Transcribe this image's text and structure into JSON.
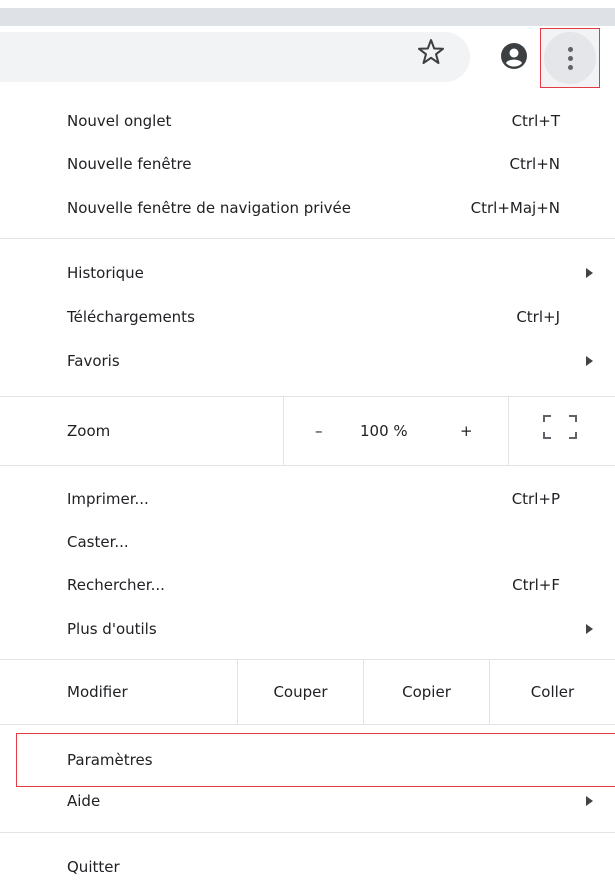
{
  "toolbar": {
    "star_icon": "star-icon",
    "account_icon": "account-icon",
    "menu_icon": "three-dot-menu-icon"
  },
  "menu": {
    "group1": [
      {
        "label": "Nouvel onglet",
        "shortcut": "Ctrl+T"
      },
      {
        "label": "Nouvelle fenêtre",
        "shortcut": "Ctrl+N"
      },
      {
        "label": "Nouvelle fenêtre de navigation privée",
        "shortcut": "Ctrl+Maj+N"
      }
    ],
    "group2": [
      {
        "label": "Historique",
        "has_submenu": true
      },
      {
        "label": "Téléchargements",
        "shortcut": "Ctrl+J"
      },
      {
        "label": "Favoris",
        "has_submenu": true
      }
    ],
    "zoom": {
      "label": "Zoom",
      "minus": "–",
      "value": "100 %",
      "plus": "+"
    },
    "group3": [
      {
        "label": "Imprimer...",
        "shortcut": "Ctrl+P"
      },
      {
        "label": "Caster..."
      },
      {
        "label": "Rechercher...",
        "shortcut": "Ctrl+F"
      },
      {
        "label": "Plus d'outils",
        "has_submenu": true
      }
    ],
    "edit": {
      "label": "Modifier",
      "cut": "Couper",
      "copy": "Copier",
      "paste": "Coller"
    },
    "settings": {
      "label": "Paramètres"
    },
    "help": {
      "label": "Aide",
      "has_submenu": true
    },
    "quit": {
      "label": "Quitter"
    }
  },
  "colors": {
    "highlight": "#e53945",
    "omnibox": "#f1f3f4",
    "text": "#202124"
  }
}
